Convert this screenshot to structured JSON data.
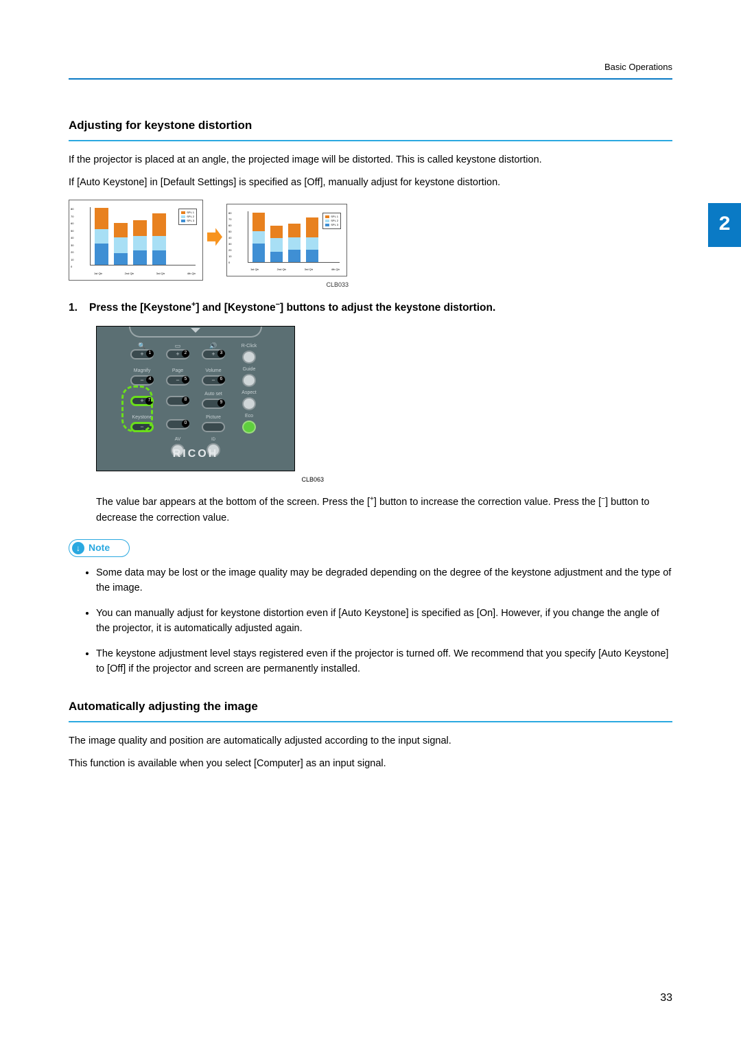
{
  "header": {
    "section_label": "Basic Operations"
  },
  "chapter_tab": "2",
  "page_number": "33",
  "section1": {
    "title": "Adjusting for keystone distortion",
    "para1": "If the projector is placed at an angle, the projected image will be distorted. This is called keystone distortion.",
    "para2": "If [Auto Keystone] in [Default Settings] is specified as [Off], manually adjust for keystone distortion.",
    "figure_id": "CLB033",
    "step1_num": "1.",
    "step1_text_a": "Press the [Keystone",
    "step1_text_b": "] and [Keystone",
    "step1_text_c": "] buttons to adjust the keystone distortion.",
    "remote_figure_id": "CLB063",
    "step1_result_a": "The value bar appears at the bottom of the screen. Press the [",
    "step1_result_b": "] button to increase the correction value. Press the [",
    "step1_result_c": "] button to decrease the correction value."
  },
  "note": {
    "label": "Note",
    "items": [
      "Some data may be lost or the image quality may be degraded depending on the degree of the keystone adjustment and the type of the image.",
      "You can manually adjust for keystone distortion even if [Auto Keystone] is specified as [On]. However, if you change the angle of the projector, it is automatically adjusted again.",
      "The keystone adjustment level stays registered even if the projector is turned off. We recommend that you specify [Auto Keystone] to [Off] if the projector and screen are permanently installed."
    ]
  },
  "section2": {
    "title": "Automatically adjusting the image",
    "para1": "The image quality and position are automatically adjusted according to the input signal.",
    "para2": "This function is available when you select [Computer] as an input signal."
  },
  "remote": {
    "brand": "RICOH",
    "btn_labels": {
      "magnify": "Magnify",
      "page": "Page",
      "volume": "Volume",
      "guide": "Guide",
      "autoset": "Auto set",
      "aspect": "Aspect",
      "keystone": "Keystone",
      "picture": "Picture",
      "eco": "Eco",
      "av": "AV",
      "rclick": "R-Click"
    }
  },
  "chart_data": [
    {
      "type": "bar",
      "title": "",
      "categories": [
        "1st Qtr",
        "2nd Qtr",
        "3rd Qtr",
        "4th Qtr"
      ],
      "series": [
        {
          "name": "SPL 1",
          "values": [
            30,
            20,
            22,
            32
          ],
          "color": "#e8811f"
        },
        {
          "name": "SPL 2",
          "values": [
            20,
            22,
            20,
            20
          ],
          "color": "#a8dff5"
        },
        {
          "name": "SPL 3",
          "values": [
            30,
            16,
            20,
            20
          ],
          "color": "#3f8fd4"
        }
      ],
      "ylim": [
        0,
        80
      ],
      "yticks": [
        0,
        10,
        20,
        30,
        40,
        50,
        60,
        70,
        80
      ],
      "stacked": true,
      "note": "Distorted (keystoned) version of chart — left panel"
    },
    {
      "type": "bar",
      "title": "",
      "categories": [
        "1st Qtr",
        "2nd Qtr",
        "3rd Qtr",
        "4th Qtr"
      ],
      "series": [
        {
          "name": "SPL 1",
          "values": [
            30,
            20,
            22,
            32
          ],
          "color": "#e8811f"
        },
        {
          "name": "SPL 2",
          "values": [
            20,
            22,
            20,
            20
          ],
          "color": "#a8dff5"
        },
        {
          "name": "SPL 3",
          "values": [
            30,
            16,
            20,
            20
          ],
          "color": "#3f8fd4"
        }
      ],
      "ylim": [
        0,
        80
      ],
      "yticks": [
        0,
        10,
        20,
        30,
        40,
        50,
        60,
        70,
        80
      ],
      "stacked": true,
      "note": "Corrected version of chart — right panel"
    }
  ]
}
